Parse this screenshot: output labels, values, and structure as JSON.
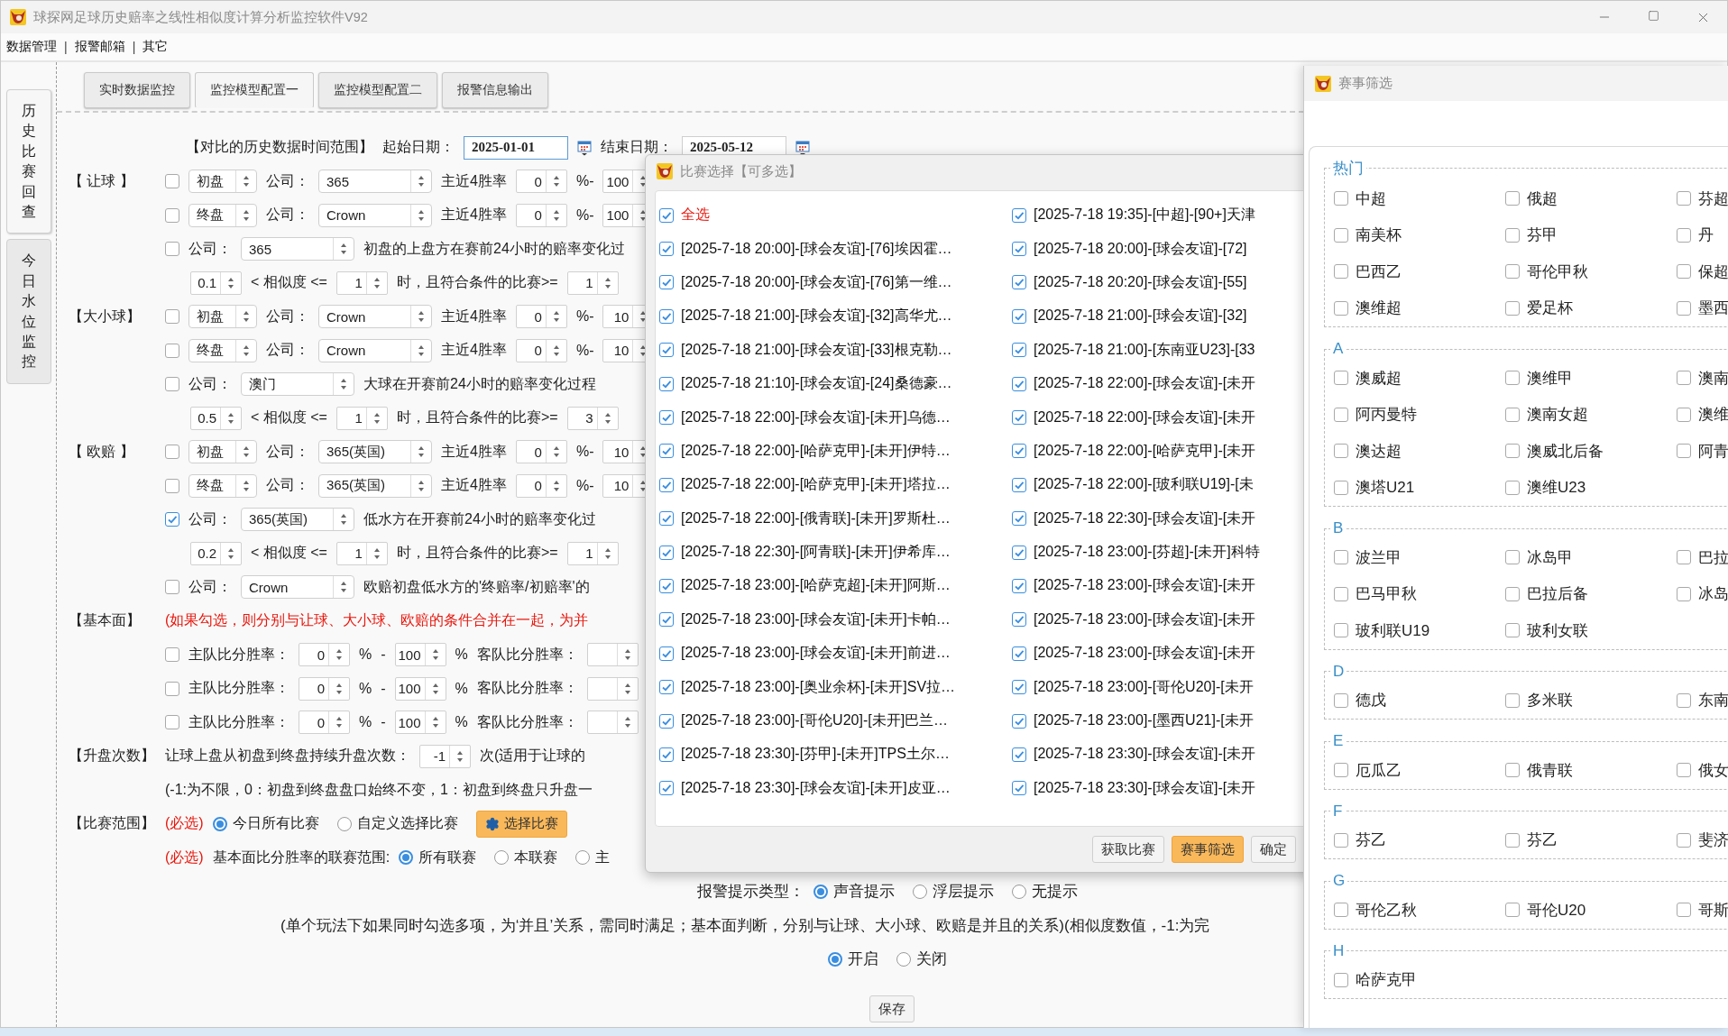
{
  "window": {
    "title": "球探网足球历史赔率之线性相似度计算分析监控软件V92"
  },
  "menu": [
    {
      "kind": "item",
      "label": "数据管理"
    },
    {
      "kind": "separator",
      "label": "|"
    },
    {
      "kind": "item",
      "label": "报警邮箱"
    },
    {
      "kind": "separator",
      "label": "|"
    },
    {
      "kind": "item",
      "label": "其它"
    }
  ],
  "side_tabs": [
    {
      "label": "历史比赛回查",
      "selected": true
    },
    {
      "label": "今日水位监控",
      "selected": false
    }
  ],
  "tabs": [
    {
      "label": "实时数据监控",
      "selected": false
    },
    {
      "label": "监控模型配置一",
      "selected": true
    },
    {
      "label": "监控模型配置二",
      "selected": false
    },
    {
      "label": "报警信息输出",
      "selected": false
    }
  ],
  "form": {
    "rows": [
      {
        "kind": "date",
        "items": [
          {
            "kind": "label",
            "text": "【对比的历史数据时间范围】"
          },
          {
            "kind": "label",
            "text": "起始日期："
          },
          {
            "kind": "date",
            "value": "2025-01-01",
            "focused": true
          },
          {
            "kind": "calendar"
          },
          {
            "kind": "label",
            "text": "结束日期："
          },
          {
            "kind": "date",
            "value": "2025-05-12",
            "focused": false
          },
          {
            "kind": "calendar"
          }
        ]
      },
      {
        "kind": "main",
        "section": "【 让球 】",
        "items": [
          {
            "kind": "checkbox",
            "checked": false
          },
          {
            "kind": "phase_select",
            "value": "初盘"
          },
          {
            "kind": "label",
            "text": "公司："
          },
          {
            "kind": "company_select",
            "value": "365"
          },
          {
            "kind": "label",
            "text": "主近4胜率"
          },
          {
            "kind": "spin",
            "value": "0"
          },
          {
            "kind": "label",
            "text": "%-"
          },
          {
            "kind": "spin",
            "value": "100"
          }
        ]
      },
      {
        "kind": "main",
        "items": [
          {
            "kind": "checkbox",
            "checked": false
          },
          {
            "kind": "phase_select",
            "value": "终盘"
          },
          {
            "kind": "label",
            "text": "公司："
          },
          {
            "kind": "company_select",
            "value": "Crown"
          },
          {
            "kind": "label",
            "text": "主近4胜率"
          },
          {
            "kind": "spin",
            "value": "0"
          },
          {
            "kind": "label",
            "text": "%-"
          },
          {
            "kind": "spin",
            "value": "100"
          }
        ]
      },
      {
        "kind": "main",
        "items": [
          {
            "kind": "checkbox",
            "checked": false
          },
          {
            "kind": "label",
            "text": "公司："
          },
          {
            "kind": "company_select",
            "value": "365"
          },
          {
            "kind": "text",
            "text": "初盘的上盘方在赛前24小时的赔率变化过"
          }
        ]
      },
      {
        "kind": "sub",
        "items": [
          {
            "kind": "spin",
            "value": "0.1"
          },
          {
            "kind": "label",
            "text": "< 相似度 <="
          },
          {
            "kind": "spin",
            "value": "1"
          },
          {
            "kind": "label",
            "text": "时，且符合条件的比赛>="
          },
          {
            "kind": "spin",
            "value": "1"
          }
        ]
      },
      {
        "kind": "main",
        "section": "【大小球】",
        "items": [
          {
            "kind": "checkbox",
            "checked": false
          },
          {
            "kind": "phase_select",
            "value": "初盘"
          },
          {
            "kind": "label",
            "text": "公司："
          },
          {
            "kind": "company_select",
            "value": "Crown"
          },
          {
            "kind": "label",
            "text": "主近4胜率"
          },
          {
            "kind": "spin",
            "value": "0"
          },
          {
            "kind": "label",
            "text": "%-"
          },
          {
            "kind": "spin",
            "value": "10"
          }
        ]
      },
      {
        "kind": "main",
        "items": [
          {
            "kind": "checkbox",
            "checked": false
          },
          {
            "kind": "phase_select",
            "value": "终盘"
          },
          {
            "kind": "label",
            "text": "公司："
          },
          {
            "kind": "company_select",
            "value": "Crown"
          },
          {
            "kind": "label",
            "text": "主近4胜率"
          },
          {
            "kind": "spin",
            "value": "0"
          },
          {
            "kind": "label",
            "text": "%-"
          },
          {
            "kind": "spin",
            "value": "10"
          }
        ]
      },
      {
        "kind": "main",
        "items": [
          {
            "kind": "checkbox",
            "checked": false
          },
          {
            "kind": "label",
            "text": "公司："
          },
          {
            "kind": "company_select",
            "value": "澳门"
          },
          {
            "kind": "text",
            "text": "大球在开赛前24小时的赔率变化过程"
          }
        ]
      },
      {
        "kind": "sub",
        "items": [
          {
            "kind": "spin",
            "value": "0.5"
          },
          {
            "kind": "label",
            "text": "< 相似度 <="
          },
          {
            "kind": "spin",
            "value": "1"
          },
          {
            "kind": "label",
            "text": "时，且符合条件的比赛>="
          },
          {
            "kind": "spin",
            "value": "3"
          }
        ]
      },
      {
        "kind": "main",
        "section": "【 欧赔 】",
        "items": [
          {
            "kind": "checkbox",
            "checked": false
          },
          {
            "kind": "phase_select",
            "value": "初盘"
          },
          {
            "kind": "label",
            "text": "公司："
          },
          {
            "kind": "company_select",
            "value": "365(英国)"
          },
          {
            "kind": "label",
            "text": "主近4胜率"
          },
          {
            "kind": "spin",
            "value": "0"
          },
          {
            "kind": "label",
            "text": "%-"
          },
          {
            "kind": "spin",
            "value": "10"
          }
        ]
      },
      {
        "kind": "main",
        "items": [
          {
            "kind": "checkbox",
            "checked": false
          },
          {
            "kind": "phase_select",
            "value": "终盘"
          },
          {
            "kind": "label",
            "text": "公司："
          },
          {
            "kind": "company_select",
            "value": "365(英国)"
          },
          {
            "kind": "label",
            "text": "主近4胜率"
          },
          {
            "kind": "spin",
            "value": "0"
          },
          {
            "kind": "label",
            "text": "%-"
          },
          {
            "kind": "spin",
            "value": "10"
          }
        ]
      },
      {
        "kind": "main",
        "items": [
          {
            "kind": "checkbox",
            "checked": true
          },
          {
            "kind": "label",
            "text": "公司："
          },
          {
            "kind": "company_select",
            "value": "365(英国)"
          },
          {
            "kind": "text",
            "text": "低水方在开赛前24小时的赔率变化过"
          }
        ]
      },
      {
        "kind": "sub",
        "items": [
          {
            "kind": "spin",
            "value": "0.2"
          },
          {
            "kind": "label",
            "text": "< 相似度 <="
          },
          {
            "kind": "spin",
            "value": "1"
          },
          {
            "kind": "label",
            "text": "时，且符合条件的比赛>="
          },
          {
            "kind": "spin",
            "value": "1"
          }
        ]
      },
      {
        "kind": "main",
        "items": [
          {
            "kind": "checkbox",
            "checked": false
          },
          {
            "kind": "label",
            "text": "公司："
          },
          {
            "kind": "company_select",
            "value": "Crown"
          },
          {
            "kind": "text",
            "text": "欧赔初盘低水方的'终赔率/初赔率'的"
          }
        ]
      },
      {
        "kind": "main",
        "section": "【基本面】",
        "items": [
          {
            "kind": "warning",
            "text": "(如果勾选，则分别与让球、大小球、欧赔的条件合并在一起，为并"
          }
        ]
      },
      {
        "kind": "main",
        "items": [
          {
            "kind": "checkbox",
            "checked": false
          },
          {
            "kind": "label",
            "text": "主队比分胜率："
          },
          {
            "kind": "spin",
            "value": "0"
          },
          {
            "kind": "label",
            "text": "%"
          },
          {
            "kind": "label",
            "text": "-"
          },
          {
            "kind": "spin",
            "value": "100"
          },
          {
            "kind": "label",
            "text": "%"
          },
          {
            "kind": "label",
            "text": "客队比分胜率："
          },
          {
            "kind": "spin"
          }
        ]
      },
      {
        "kind": "main",
        "items": [
          {
            "kind": "checkbox",
            "checked": false
          },
          {
            "kind": "label",
            "text": "主队比分胜率："
          },
          {
            "kind": "spin",
            "value": "0"
          },
          {
            "kind": "label",
            "text": "%"
          },
          {
            "kind": "label",
            "text": "-"
          },
          {
            "kind": "spin",
            "value": "100"
          },
          {
            "kind": "label",
            "text": "%"
          },
          {
            "kind": "label",
            "text": "客队比分胜率："
          },
          {
            "kind": "spin"
          }
        ]
      },
      {
        "kind": "main",
        "items": [
          {
            "kind": "checkbox",
            "checked": false
          },
          {
            "kind": "label",
            "text": "主队比分胜率："
          },
          {
            "kind": "spin",
            "value": "0"
          },
          {
            "kind": "label",
            "text": "%"
          },
          {
            "kind": "label",
            "text": "-"
          },
          {
            "kind": "spin",
            "value": "100"
          },
          {
            "kind": "label",
            "text": "%"
          },
          {
            "kind": "label",
            "text": "客队比分胜率："
          },
          {
            "kind": "spin"
          }
        ]
      },
      {
        "kind": "main",
        "section": "【升盘次数】",
        "items": [
          {
            "kind": "label",
            "text": "让球上盘从初盘到终盘持续升盘次数："
          },
          {
            "kind": "spin",
            "value": "-1"
          },
          {
            "kind": "label",
            "text": "次(适用于让球的"
          }
        ]
      },
      {
        "kind": "main",
        "items": [
          {
            "kind": "text",
            "text": "(-1:为不限，0：初盘到终盘盘口始终不变，1：初盘到终盘只升盘一"
          }
        ]
      },
      {
        "kind": "main",
        "section": "【比赛范围】",
        "items": [
          {
            "kind": "warning",
            "text": "(必选)"
          },
          {
            "kind": "radio",
            "label": "今日所有比赛",
            "selected": true
          },
          {
            "kind": "radio",
            "label": "自定义选择比赛",
            "selected": false
          },
          {
            "kind": "gear_button",
            "label": "选择比赛",
            "highlighted": true
          }
        ]
      },
      {
        "kind": "main",
        "items": [
          {
            "kind": "warning",
            "text": "(必选)"
          },
          {
            "kind": "label",
            "text": "基本面比分胜率的联赛范围:"
          },
          {
            "kind": "radio",
            "label": "所有联赛",
            "selected": true
          },
          {
            "kind": "radio",
            "label": "本联赛",
            "selected": false
          },
          {
            "kind": "radio",
            "label": "主",
            "selected": false
          }
        ]
      },
      {
        "kind": "center",
        "items": [
          {
            "kind": "label",
            "text": "报警提示类型："
          },
          {
            "kind": "radio",
            "label": "声音提示",
            "selected": true
          },
          {
            "kind": "radio",
            "label": "浮层提示",
            "selected": false
          },
          {
            "kind": "radio",
            "label": "无提示",
            "selected": false
          }
        ]
      },
      {
        "kind": "note",
        "items": [
          {
            "kind": "text",
            "text": "(单个玩法下如果同时勾选多项，为‘并且’关系，需同时满足；基本面判断，分别与让球、大小球、欧赔是并且的关系)(相似度数值，-1:为完"
          }
        ]
      },
      {
        "kind": "center",
        "items": [
          {
            "kind": "radio",
            "label": "开启",
            "selected": true
          },
          {
            "kind": "radio",
            "label": "关闭",
            "selected": false
          }
        ]
      },
      {
        "kind": "footer",
        "items": [
          {
            "kind": "button",
            "label": "保存",
            "highlighted": false
          }
        ]
      }
    ]
  },
  "match_dialog": {
    "title": "比赛选择【可多选】",
    "matches": [
      {
        "kind": "all",
        "label": "全选",
        "checked": true
      },
      {
        "kind": "match",
        "label": "[2025-7-18 19:35]-[中超]-[90+]天津",
        "checked": true
      },
      {
        "kind": "match",
        "label": "[2025-7-18 20:00]-[球会友谊]-[76]埃因霍…",
        "checked": true
      },
      {
        "kind": "match",
        "label": "[2025-7-18 20:00]-[球会友谊]-[72]",
        "checked": true
      },
      {
        "kind": "match",
        "label": "[2025-7-18 20:00]-[球会友谊]-[76]第一维…",
        "checked": true
      },
      {
        "kind": "match",
        "label": "[2025-7-18 20:20]-[球会友谊]-[55]",
        "checked": true
      },
      {
        "kind": "match",
        "label": "[2025-7-18 21:00]-[球会友谊]-[32]高华尤…",
        "checked": true
      },
      {
        "kind": "match",
        "label": "[2025-7-18 21:00]-[球会友谊]-[32]",
        "checked": true
      },
      {
        "kind": "match",
        "label": "[2025-7-18 21:00]-[球会友谊]-[33]根克勒…",
        "checked": true
      },
      {
        "kind": "match",
        "label": "[2025-7-18 21:00]-[东南亚U23]-[33",
        "checked": true
      },
      {
        "kind": "match",
        "label": "[2025-7-18 21:10]-[球会友谊]-[24]桑德豪…",
        "checked": true
      },
      {
        "kind": "match",
        "label": "[2025-7-18 22:00]-[球会友谊]-[未开",
        "checked": true
      },
      {
        "kind": "match",
        "label": "[2025-7-18 22:00]-[球会友谊]-[未开]乌德…",
        "checked": true
      },
      {
        "kind": "match",
        "label": "[2025-7-18 22:00]-[球会友谊]-[未开",
        "checked": true
      },
      {
        "kind": "match",
        "label": "[2025-7-18 22:00]-[哈萨克甲]-[未开]伊特…",
        "checked": true
      },
      {
        "kind": "match",
        "label": "[2025-7-18 22:00]-[哈萨克甲]-[未开",
        "checked": true
      },
      {
        "kind": "match",
        "label": "[2025-7-18 22:00]-[哈萨克甲]-[未开]塔拉…",
        "checked": true
      },
      {
        "kind": "match",
        "label": "[2025-7-18 22:00]-[玻利联U19]-[未",
        "checked": true
      },
      {
        "kind": "match",
        "label": "[2025-7-18 22:00]-[俄青联]-[未开]罗斯杜…",
        "checked": true
      },
      {
        "kind": "match",
        "label": "[2025-7-18 22:30]-[球会友谊]-[未开",
        "checked": true
      },
      {
        "kind": "match",
        "label": "[2025-7-18 22:30]-[阿青联]-[未开]伊希库…",
        "checked": true
      },
      {
        "kind": "match",
        "label": "[2025-7-18 23:00]-[芬超]-[未开]科特",
        "checked": true
      },
      {
        "kind": "match",
        "label": "[2025-7-18 23:00]-[哈萨克超]-[未开]阿斯…",
        "checked": true
      },
      {
        "kind": "match",
        "label": "[2025-7-18 23:00]-[球会友谊]-[未开",
        "checked": true
      },
      {
        "kind": "match",
        "label": "[2025-7-18 23:00]-[球会友谊]-[未开]卡帕…",
        "checked": true
      },
      {
        "kind": "match",
        "label": "[2025-7-18 23:00]-[球会友谊]-[未开",
        "checked": true
      },
      {
        "kind": "match",
        "label": "[2025-7-18 23:00]-[球会友谊]-[未开]前进…",
        "checked": true
      },
      {
        "kind": "match",
        "label": "[2025-7-18 23:00]-[球会友谊]-[未开",
        "checked": true
      },
      {
        "kind": "match",
        "label": "[2025-7-18 23:00]-[奥业余杯]-[未开]SV拉…",
        "checked": true
      },
      {
        "kind": "match",
        "label": "[2025-7-18 23:00]-[哥伦U20]-[未开",
        "checked": true
      },
      {
        "kind": "match",
        "label": "[2025-7-18 23:00]-[哥伦U20]-[未开]巴兰…",
        "checked": true
      },
      {
        "kind": "match",
        "label": "[2025-7-18 23:00]-[墨西U21]-[未开",
        "checked": true
      },
      {
        "kind": "match",
        "label": "[2025-7-18 23:30]-[芬甲]-[未开]TPS土尔…",
        "checked": true
      },
      {
        "kind": "match",
        "label": "[2025-7-18 23:30]-[球会友谊]-[未开",
        "checked": true
      },
      {
        "kind": "match",
        "label": "[2025-7-18 23:30]-[球会友谊]-[未开]皮亚…",
        "checked": true
      },
      {
        "kind": "match",
        "label": "[2025-7-18 23:30]-[球会友谊]-[未开",
        "checked": true
      }
    ],
    "buttons": [
      {
        "label": "获取比赛",
        "highlighted": false
      },
      {
        "label": "赛事筛选",
        "highlighted": true
      },
      {
        "label": "确定",
        "highlighted": false
      }
    ]
  },
  "filter_panel": {
    "title": "赛事筛选",
    "groups": [
      {
        "title": "热门",
        "leagues": [
          {
            "label": "中超",
            "checked": false
          },
          {
            "label": "俄超",
            "checked": false
          },
          {
            "label": "芬超",
            "checked": false
          },
          {
            "label": "南美杯",
            "checked": false
          },
          {
            "label": "芬甲",
            "checked": false
          },
          {
            "label": "丹",
            "checked": false
          },
          {
            "label": "巴西乙",
            "checked": false
          },
          {
            "label": "哥伦甲秋",
            "checked": false
          },
          {
            "label": "保超",
            "checked": false
          },
          {
            "label": "澳维超",
            "checked": false
          },
          {
            "label": "爱足杯",
            "checked": false
          },
          {
            "label": "墨西",
            "checked": false
          }
        ]
      },
      {
        "title": "A",
        "leagues": [
          {
            "label": "澳威超",
            "checked": false
          },
          {
            "label": "澳维甲",
            "checked": false
          },
          {
            "label": "澳南",
            "checked": false
          },
          {
            "label": "阿丙曼特",
            "checked": false
          },
          {
            "label": "澳南女超",
            "checked": false
          },
          {
            "label": "澳维",
            "checked": false
          },
          {
            "label": "澳达超",
            "checked": false
          },
          {
            "label": "澳威北后备",
            "checked": false
          },
          {
            "label": "阿青",
            "checked": false
          },
          {
            "label": "澳塔U21",
            "checked": false
          },
          {
            "label": "澳维U23",
            "checked": false
          }
        ]
      },
      {
        "title": "B",
        "leagues": [
          {
            "label": "波兰甲",
            "checked": false
          },
          {
            "label": "冰岛甲",
            "checked": false
          },
          {
            "label": "巴拉",
            "checked": false
          },
          {
            "label": "巴马甲秋",
            "checked": false
          },
          {
            "label": "巴拉后备",
            "checked": false
          },
          {
            "label": "冰岛",
            "checked": false
          },
          {
            "label": "玻利联U19",
            "checked": false
          },
          {
            "label": "玻利女联",
            "checked": false
          }
        ]
      },
      {
        "title": "D",
        "leagues": [
          {
            "label": "德戊",
            "checked": false
          },
          {
            "label": "多米联",
            "checked": false
          },
          {
            "label": "东南",
            "checked": false
          }
        ]
      },
      {
        "title": "E",
        "leagues": [
          {
            "label": "厄瓜乙",
            "checked": false
          },
          {
            "label": "俄青联",
            "checked": false
          },
          {
            "label": "俄女",
            "checked": false
          }
        ]
      },
      {
        "title": "F",
        "leagues": [
          {
            "label": "芬乙",
            "checked": false
          },
          {
            "label": "芬乙",
            "checked": false
          },
          {
            "label": "斐济",
            "checked": false
          }
        ]
      },
      {
        "title": "G",
        "leagues": [
          {
            "label": "哥伦乙秋",
            "checked": false
          },
          {
            "label": "哥伦U20",
            "checked": false
          },
          {
            "label": "哥斯",
            "checked": false
          }
        ]
      },
      {
        "title": "H",
        "leagues": [
          {
            "label": "哈萨克甲",
            "checked": false
          }
        ]
      }
    ]
  }
}
